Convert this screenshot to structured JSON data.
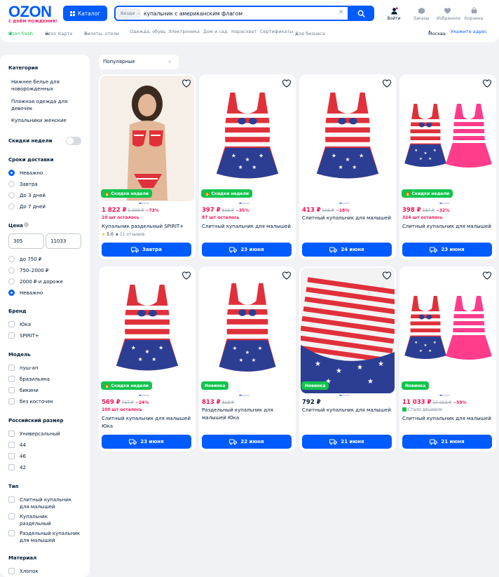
{
  "header": {
    "logo": "OZON",
    "logo_sub": "С ДНЁМ РОЖДЕНИЯ!",
    "catalog_label": "Каталог",
    "search_scope": "Везде",
    "search_value": "купальник с американским флагом",
    "actions": [
      {
        "label": "Войти",
        "icon": "user-icon"
      },
      {
        "label": "Заказы",
        "icon": "box-icon"
      },
      {
        "label": "Избранное",
        "icon": "heart-icon"
      },
      {
        "label": "Корзина",
        "icon": "cart-icon"
      }
    ]
  },
  "nav": {
    "links": [
      "Ozon fresh",
      "Ozon Карта",
      "Билеты, отели",
      "Одежда, обувь",
      "Электроника",
      "Дом и сад",
      "Нарасхват",
      "Сертификаты",
      "Для бизнеса"
    ],
    "city": "Москва",
    "address_link": "Укажите адрес"
  },
  "sort": {
    "value": "Популярные"
  },
  "filters": {
    "category": {
      "title": "Категория",
      "items": [
        "Нижнее белье для новорожденных",
        "Пляжная одежда для девочек",
        "Купальники женские"
      ]
    },
    "weekly_discounts": "Скидки недели",
    "delivery": {
      "title": "Сроки доставки",
      "options": [
        "Неважно",
        "Завтра",
        "До 3 дней",
        "До 7 дней"
      ],
      "selected": "Неважно"
    },
    "price": {
      "title": "Цена",
      "from": "305",
      "to": "11033",
      "options": [
        "до 750 ₽",
        "750–2000 ₽",
        "2000 ₽ и дороже",
        "Неважно"
      ],
      "selected": "Неважно"
    },
    "brand": {
      "title": "Бренд",
      "items": [
        "Юка",
        "SPIRIT+"
      ]
    },
    "model": {
      "title": "Модель",
      "items": [
        "пуш-ап",
        "бразильяна",
        "бикини",
        "без косточек"
      ]
    },
    "size": {
      "title": "Российский размер",
      "items": [
        "Универсальный",
        "44",
        "46",
        "42"
      ]
    },
    "type": {
      "title": "Тип",
      "items": [
        "Слитный купальник для малышей",
        "Купальник раздельный",
        "Раздельный купальник для малышей"
      ]
    },
    "material": {
      "title": "Материал",
      "items": [
        "Хлопок"
      ]
    }
  },
  "products": [
    {
      "badge": "Скидки недели",
      "price": "1 822 ₽",
      "old": "5 999 ₽",
      "disc": "−73%",
      "stock": "10 шт осталось",
      "name": "Купальник раздельный SPIRIT+",
      "rating": "5.0",
      "reviews": "11 отзывов",
      "delivery": "Завтра",
      "sale": true
    },
    {
      "badge": "Скидки недели",
      "price": "397 ₽",
      "old": "818 ₽",
      "disc": "−35%",
      "stock": "87 шт осталось",
      "name": "Слитный купальник для малышей",
      "delivery": "23 июня",
      "sale": true
    },
    {
      "badge": "",
      "price": "413 ₽",
      "old": "506 ₽",
      "disc": "−18%",
      "stock": "",
      "name": "Слитный купальник для малышей",
      "delivery": "24 июня",
      "sale": true
    },
    {
      "badge": "Скидки недели",
      "price": "398 ₽",
      "old": "587 ₽",
      "disc": "−32%",
      "stock": "324 шт осталось",
      "name": "Слитный купальник для малышей",
      "delivery": "23 июня",
      "sale": true
    },
    {
      "badge": "Скидки недели",
      "price": "569 ₽",
      "old": "757 ₽",
      "disc": "−24%",
      "stock": "100 шт осталось",
      "name": "Слитный купальник для малышей Юка",
      "delivery": "23 июня",
      "sale": true
    },
    {
      "badge": "Новинка",
      "price": "813 ₽",
      "old": "818 ₽",
      "disc": "",
      "stock": "",
      "name": "Раздельный купальник для малышей Юка",
      "delivery": "22 июня",
      "sale": true
    },
    {
      "badge": "Новинка",
      "price": "792 ₽",
      "old": "",
      "disc": "",
      "stock": "",
      "name": "Слитный купальник для малышей",
      "delivery": "21 июня",
      "sale": false
    },
    {
      "badge": "Новинка",
      "price": "11 033 ₽",
      "old": "27 003 ₽",
      "disc": "−59%",
      "stock": "",
      "cheaper": "Стало дешевле",
      "name": "Слитный купальник для малышей",
      "delivery": "21 июня",
      "sale": true
    }
  ],
  "colors": {
    "brand": "#005bff",
    "sale": "#f91155",
    "badge": "#10c44c"
  }
}
